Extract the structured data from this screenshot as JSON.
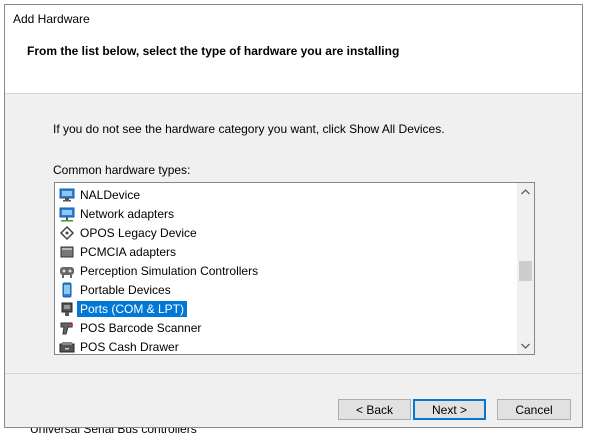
{
  "dialog": {
    "title": "Add Hardware",
    "subtitle": "From the list below, select the type of hardware you are installing",
    "instruction": "If you do not see the hardware category you want, click Show All Devices.",
    "list_label": "Common hardware types:"
  },
  "hardware_list": [
    {
      "label": "NALDevice",
      "icon": "monitor-icon",
      "selected": false
    },
    {
      "label": "Network adapters",
      "icon": "network-adapter-icon",
      "selected": false
    },
    {
      "label": "OPOS Legacy Device",
      "icon": "opos-device-icon",
      "selected": false
    },
    {
      "label": "PCMCIA adapters",
      "icon": "pcmcia-card-icon",
      "selected": false
    },
    {
      "label": "Perception Simulation Controllers",
      "icon": "controller-icon",
      "selected": false
    },
    {
      "label": "Portable Devices",
      "icon": "portable-device-icon",
      "selected": false
    },
    {
      "label": "Ports (COM & LPT)",
      "icon": "port-connector-icon",
      "selected": true
    },
    {
      "label": "POS Barcode Scanner",
      "icon": "barcode-scanner-icon",
      "selected": false
    },
    {
      "label": "POS Cash Drawer",
      "icon": "cash-drawer-icon",
      "selected": false
    }
  ],
  "buttons": {
    "back": "< Back",
    "next": "Next >",
    "cancel": "Cancel"
  },
  "background": {
    "bottom_text": "Universal Serial Bus controllers"
  },
  "colors": {
    "selection": "#0078d7",
    "dialog_bg": "#f0f0f0"
  }
}
